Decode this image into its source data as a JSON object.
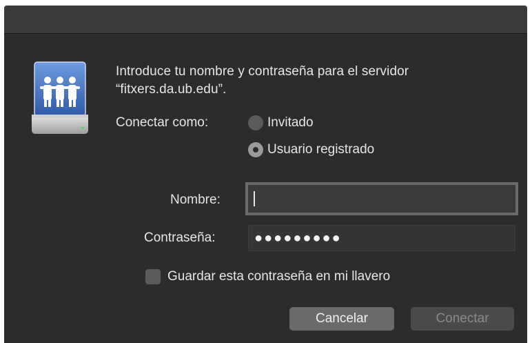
{
  "dialog": {
    "prompt": "Introduce tu nombre y contraseña para el servidor “fitxers.da.ub.edu”.",
    "connect_as_label": "Conectar como:",
    "options": [
      {
        "label": "Invitado",
        "selected": false
      },
      {
        "label": "Usuario registrado",
        "selected": true
      }
    ],
    "name_label": "Nombre:",
    "name_value": "",
    "password_label": "Contraseña:",
    "password_masked": "●●●●●●●●●",
    "remember_label": "Guardar esta contraseña en mi llavero",
    "remember_checked": false,
    "cancel_label": "Cancelar",
    "connect_label": "Conectar"
  },
  "icons": {
    "server": "shared-server-icon"
  },
  "colors": {
    "background": "#2c2c2c",
    "text": "#e6e6e6",
    "disabled_text": "#8a8a8a"
  }
}
